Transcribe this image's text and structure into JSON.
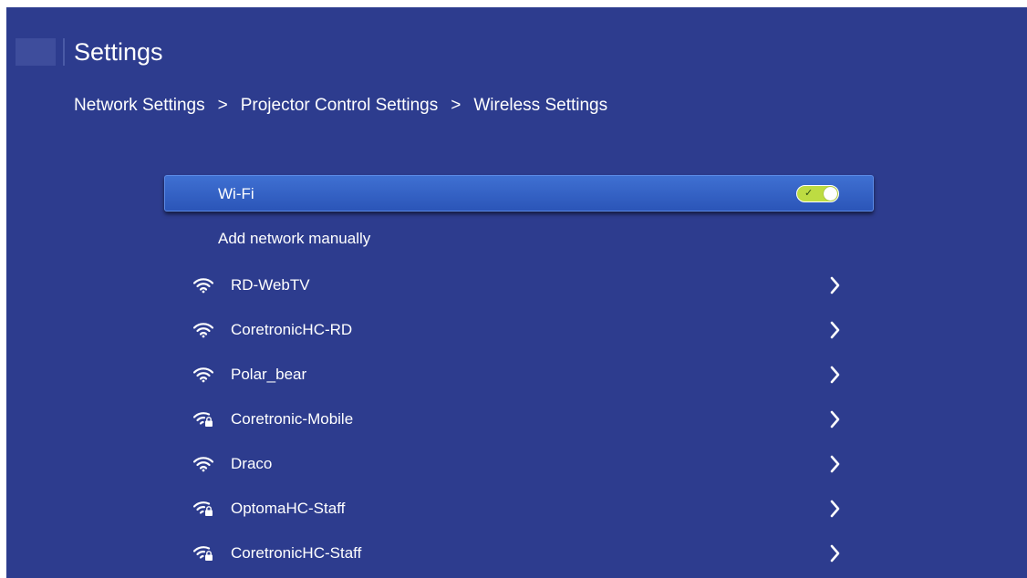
{
  "header": {
    "title": "Settings",
    "breadcrumb": [
      "Network Settings",
      "Projector Control Settings",
      "Wireless Settings"
    ],
    "separator": ">"
  },
  "wifi": {
    "label": "Wi-Fi",
    "enabled": true,
    "toggle_check": "✓"
  },
  "add_network_label": "Add network manually",
  "networks": [
    {
      "name": "RD-WebTV",
      "secured": false
    },
    {
      "name": "CoretronicHC-RD",
      "secured": false
    },
    {
      "name": "Polar_bear",
      "secured": false
    },
    {
      "name": "Coretronic-Mobile",
      "secured": true
    },
    {
      "name": "Draco",
      "secured": false
    },
    {
      "name": "OptomaHC-Staff",
      "secured": true
    },
    {
      "name": "CoretronicHC-Staff",
      "secured": true
    }
  ],
  "colors": {
    "background": "#2d3c8e",
    "selected_row": "#3563c6",
    "toggle_on": "#bddc42"
  }
}
